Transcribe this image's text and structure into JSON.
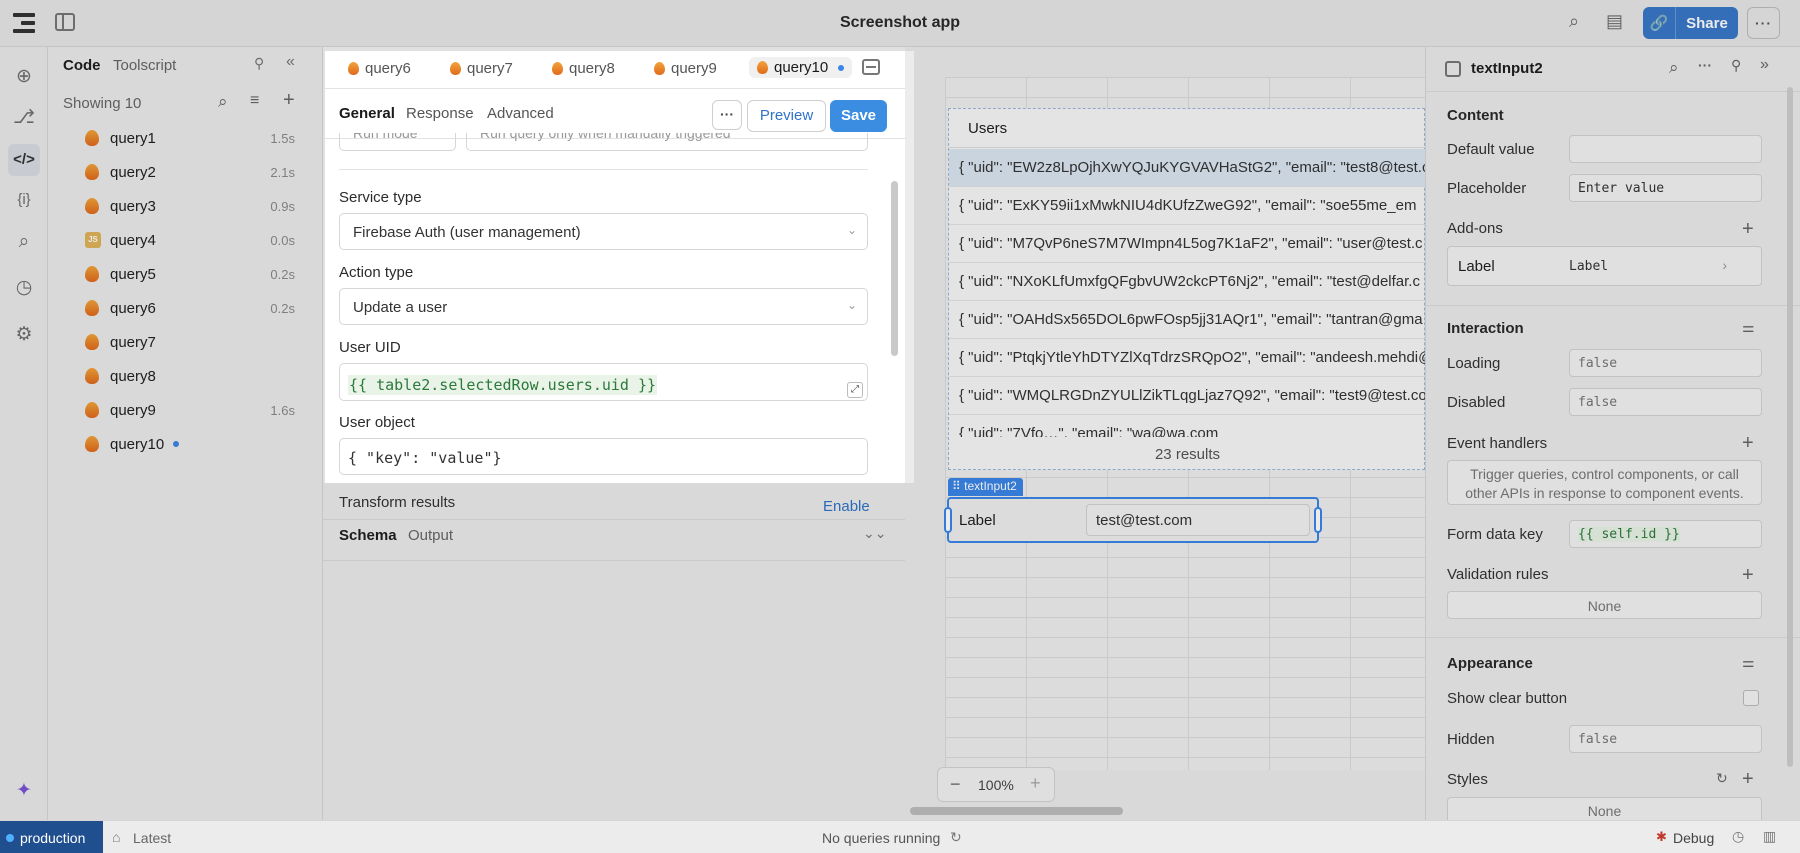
{
  "app": {
    "title": "Screenshot app",
    "share_label": "Share"
  },
  "code_panel": {
    "tabs": [
      "Code",
      "Toolscript"
    ],
    "showing": "Showing 10",
    "queries": [
      {
        "name": "query1",
        "time": "1.5s",
        "type": "firebase"
      },
      {
        "name": "query2",
        "time": "2.1s",
        "type": "firebase"
      },
      {
        "name": "query3",
        "time": "0.9s",
        "type": "firebase"
      },
      {
        "name": "query4",
        "time": "0.0s",
        "type": "js"
      },
      {
        "name": "query5",
        "time": "0.2s",
        "type": "firebase"
      },
      {
        "name": "query6",
        "time": "0.2s",
        "type": "firebase"
      },
      {
        "name": "query7",
        "time": "",
        "type": "firebase"
      },
      {
        "name": "query8",
        "time": "",
        "type": "firebase"
      },
      {
        "name": "query9",
        "time": "1.6s",
        "type": "firebase"
      },
      {
        "name": "query10",
        "time": "",
        "type": "firebase",
        "unsaved": true
      }
    ]
  },
  "editor": {
    "tabs": [
      "query6",
      "query7",
      "query8",
      "query9",
      "query10"
    ],
    "subtabs": [
      "General",
      "Response",
      "Advanced"
    ],
    "preview_label": "Preview",
    "save_label": "Save",
    "hidden_row_left": "Run mode",
    "hidden_row_right": "Run query only when manually triggered",
    "service_type_label": "Service type",
    "service_type_value": "Firebase Auth (user management)",
    "action_type_label": "Action type",
    "action_type_value": "Update a user",
    "user_uid_label": "User UID",
    "user_uid_value": "{{ table2.selectedRow.users.uid }}",
    "user_object_label": "User object",
    "user_object_value": "{ \"key\": \"value\"}",
    "transform_label": "Transform results",
    "transform_action": "Enable",
    "bottom_tabs": [
      "Schema",
      "Output"
    ]
  },
  "canvas": {
    "table_title": "Users",
    "rows": [
      "{ \"uid\": \"EW2z8LpOjhXwYQJuKYGVAVHaStG2\", \"email\": \"test8@test.c",
      "{ \"uid\": \"ExKY59ii1xMwkNIU4dKUfzZweG92\", \"email\": \"soe55me_em",
      "{ \"uid\": \"M7QvP6neS7M7WImpn4L5og7K1aF2\", \"email\": \"user@test.c",
      "{ \"uid\": \"NXoKLfUmxfgQFgbvUW2ckcPT6Nj2\", \"email\": \"test@delfar.c",
      "{ \"uid\": \"OAHdSx565DOL6pwFOsp5jj31AQr1\", \"email\": \"tantran@gma",
      "{ \"uid\": \"PtqkjYtleYhDTYZlXqTdrzSRQpO2\", \"email\": \"andeesh.mehdi@",
      "{ \"uid\": \"WMQLRGDnZYULlZikTLqgLjaz7Q92\", \"email\": \"test9@test.co",
      "{ \"uid\": \"7Vfo…\", \"email\": \"wa@wa.com"
    ],
    "results": "23 results",
    "component_badge": "textInput2",
    "input_label": "Label",
    "input_value": "test@test.com",
    "zoom": "100%"
  },
  "inspector": {
    "title": "textInput2",
    "content_head": "Content",
    "default_value_label": "Default value",
    "placeholder_label": "Placeholder",
    "placeholder_value": "Enter value",
    "addons_label": "Add-ons",
    "addon_label_key": "Label",
    "addon_label_value": "Label",
    "interaction_head": "Interaction",
    "loading_label": "Loading",
    "loading_value": "false",
    "disabled_label": "Disabled",
    "disabled_value": "false",
    "event_handlers_label": "Event handlers",
    "event_handlers_hint": "Trigger queries, control components, or call other APIs in response to component events.",
    "form_key_label": "Form data key",
    "form_key_value": "{{ self.id }}",
    "validation_label": "Validation rules",
    "validation_value": "None",
    "appearance_head": "Appearance",
    "clear_button_label": "Show clear button",
    "hidden_label": "Hidden",
    "hidden_value": "false",
    "styles_label": "Styles",
    "styles_value": "None"
  },
  "status": {
    "environment": "production",
    "version": "Latest",
    "queries_running": "No queries running",
    "debug": "Debug"
  }
}
